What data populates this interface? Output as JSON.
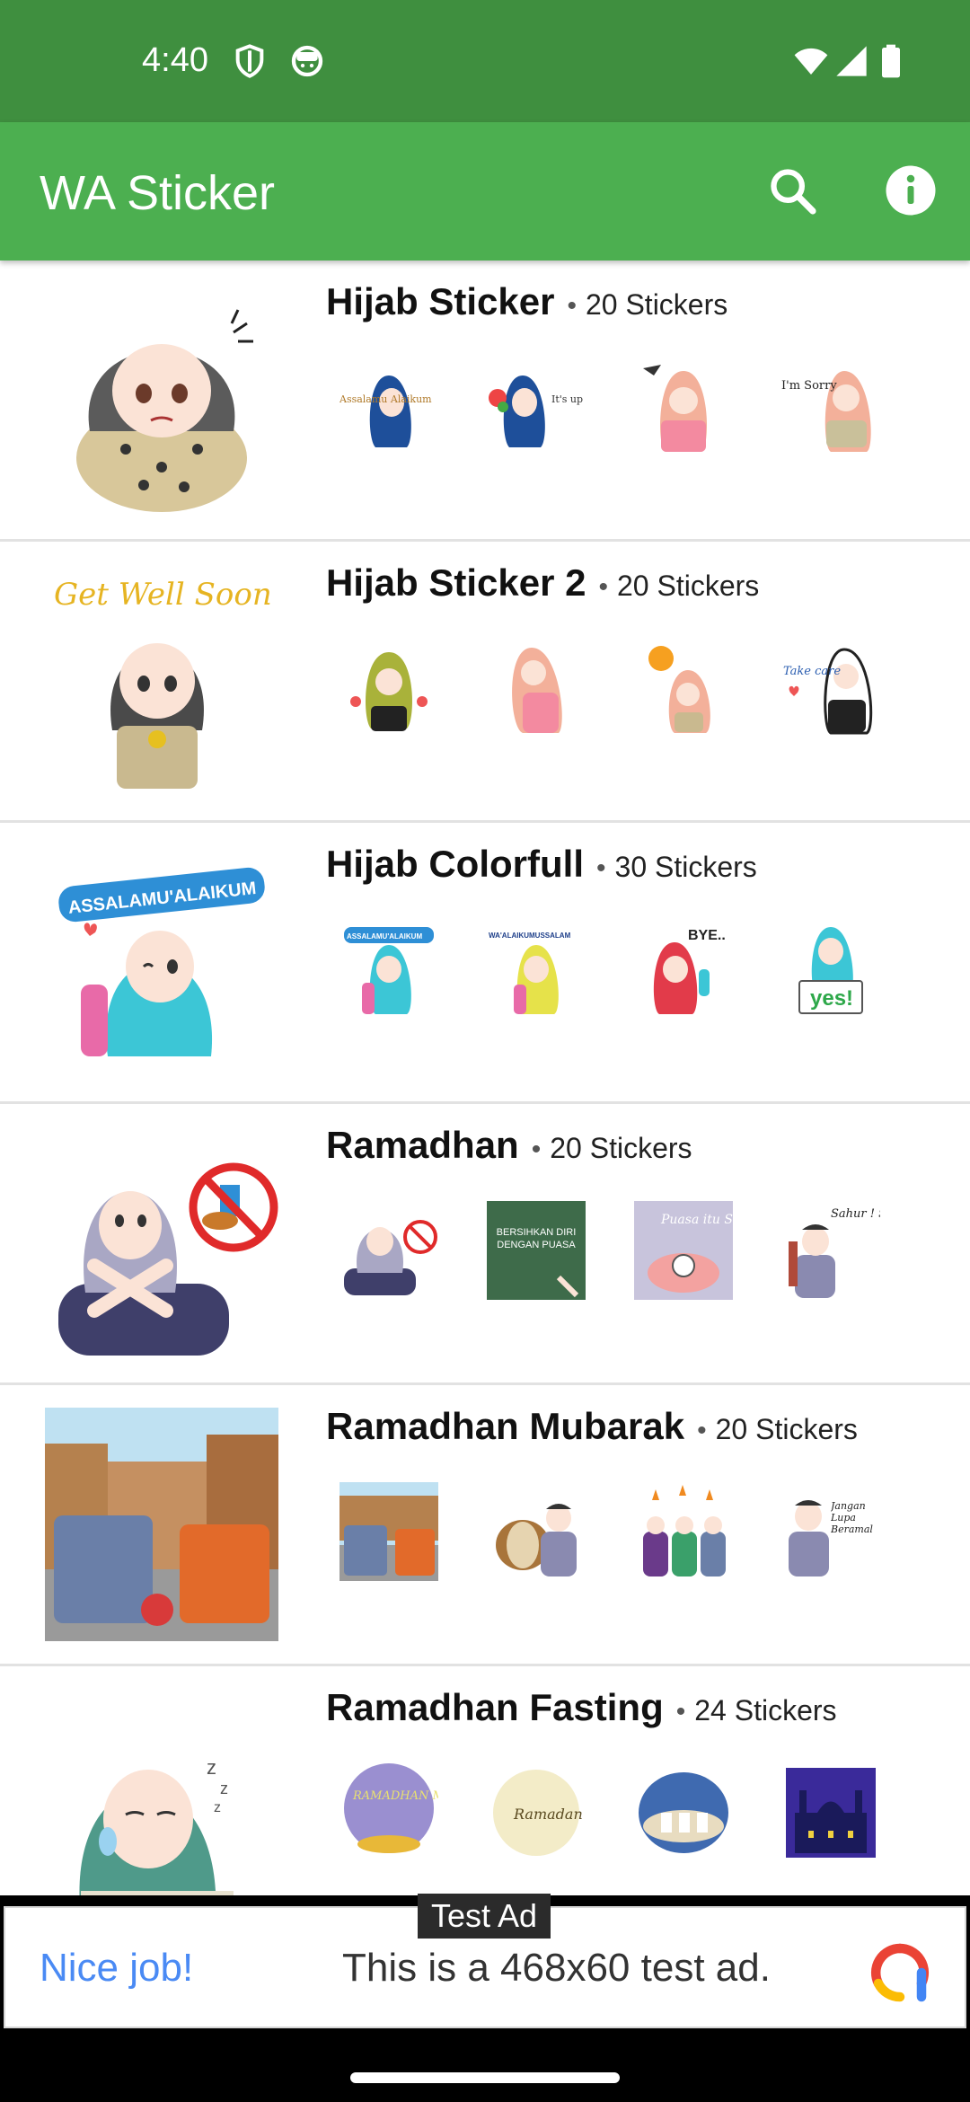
{
  "status_bar": {
    "time": "4:40"
  },
  "app_bar": {
    "title": "WA Sticker",
    "search_icon": "search-icon",
    "info_icon": "info-icon"
  },
  "theme": {
    "status_bar_color": "#3f8f3f",
    "app_bar_color": "#4caf50"
  },
  "packs": [
    {
      "name": "Hijab Sticker",
      "count": "20 Stickers",
      "preview_texts": [
        "Assalamu Alaikum",
        "It's up to you",
        "",
        "I'm Sorry"
      ]
    },
    {
      "name": "Hijab Sticker 2",
      "count": "20 Stickers",
      "tray_text": "Get Well Soon",
      "preview_texts": [
        "",
        "",
        "",
        "Take care"
      ]
    },
    {
      "name": "Hijab Colorfull",
      "count": "30 Stickers",
      "tray_text": "ASSALAMU'ALAIKUM",
      "preview_texts": [
        "ASSALAMU'ALAIKUM",
        "WA'ALAIKUMUSSALAM",
        "BYE..",
        "yes!"
      ]
    },
    {
      "name": "Ramadhan",
      "count": "20 Stickers",
      "preview_texts": [
        "",
        "BERSIHKAN DIRI DENGAN PUASA",
        "Puasa itu Sehat",
        "Sahur ! Sahur !"
      ]
    },
    {
      "name": "Ramadhan Mubarak",
      "count": "20 Stickers",
      "preview_texts": [
        "",
        "",
        "",
        "Jangan Lupa Beramal"
      ]
    },
    {
      "name": "Ramadhan Fasting",
      "count": "24 Stickers",
      "preview_texts": [
        "RAMADHAN Mubarak",
        "Ramadan",
        "",
        ""
      ]
    }
  ],
  "ad": {
    "label": "Test Ad",
    "headline": "Nice job!",
    "text": "This is a 468x60 test ad."
  }
}
